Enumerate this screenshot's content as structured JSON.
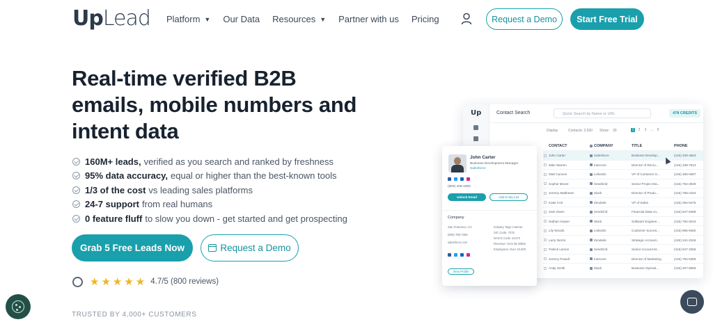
{
  "nav": {
    "logo_up": "Up",
    "logo_lead": "Lead",
    "menu": [
      {
        "label": "Platform",
        "dropdown": true
      },
      {
        "label": "Our Data",
        "dropdown": false
      },
      {
        "label": "Resources",
        "dropdown": true
      },
      {
        "label": "Partner with us",
        "dropdown": false
      },
      {
        "label": "Pricing",
        "dropdown": false
      }
    ],
    "request_demo": "Request a Demo",
    "start_trial": "Start Free Trial"
  },
  "hero": {
    "title": "Real-time verified B2B emails, mobile numbers and intent data",
    "features": [
      {
        "bold": "160M+ leads,",
        "rest": "verified as you search and ranked by freshness"
      },
      {
        "bold": "95% data accuracy,",
        "rest": "equal or higher than the best-known tools"
      },
      {
        "bold": "1/3 of the cost",
        "rest": "vs leading sales platforms"
      },
      {
        "bold": "24-7 support",
        "rest": "from real humans"
      },
      {
        "bold": "0 feature fluff",
        "rest": "to slow you down - get started and get prospecting"
      }
    ],
    "cta_primary": "Grab 5 Free Leads Now",
    "cta_secondary": "Request a Demo",
    "rating_text": "4.7/5 (800 reviews)",
    "stars": "★★★★★",
    "trusted": "TRUSTED BY 4,000+ CUSTOMERS"
  },
  "app": {
    "logo": "Up",
    "header_title": "Contact Search",
    "search_placeholder": "Quick Search by Name or URL",
    "credits": "478 CREDITS",
    "toolbar": {
      "display": "Display",
      "contacts": "Contacts: 2,500",
      "show": "Show:",
      "show_val": "30",
      "pages": [
        "1",
        "2",
        "3",
        "...",
        "9"
      ]
    },
    "columns": [
      "CONTACT",
      "COMPANY",
      "TITLE",
      "PHONE"
    ],
    "rows": [
      {
        "name": "John Carter",
        "company": "Salesforce",
        "title": "Business Develop...",
        "phone": "(415) 339-4563"
      },
      {
        "name": "Mike Warren",
        "company": "Intercom",
        "title": "Director of Recru...",
        "phone": "(415) 339-7513"
      },
      {
        "name": "Matt Cannon",
        "company": "LinkedIn",
        "title": "VP of Customer S...",
        "phone": "(415) 485-9487"
      },
      {
        "name": "Sophie Moore",
        "company": "SendGrid",
        "title": "Senior Project Ma...",
        "phone": "(415) 764-2849"
      },
      {
        "name": "Jeremy Matthews",
        "company": "Slack",
        "title": "Director of Produ...",
        "phone": "(415) 758-2154"
      },
      {
        "name": "Katie Corl",
        "company": "Zendesk",
        "title": "VP of Sales",
        "phone": "(415) 394-6475"
      },
      {
        "name": "Sam Owen",
        "company": "SendGrid",
        "title": "Financial Data An...",
        "phone": "(415) 847-6489"
      },
      {
        "name": "Nathan Harper",
        "company": "Slack",
        "title": "Software Enginee...",
        "phone": "(415) 784-9216"
      },
      {
        "name": "Lily Woods",
        "company": "LinkedIn",
        "title": "Customer Succes...",
        "phone": "(415) 895-9462"
      },
      {
        "name": "Larry Norris",
        "company": "Zendesk",
        "title": "Strategic Account...",
        "phone": "(415) 341-2346"
      },
      {
        "name": "Patrick Larson",
        "company": "SendGrid",
        "title": "Senior Account M...",
        "phone": "(415) 847-3256"
      },
      {
        "name": "Jeremy Powell",
        "company": "Intercom",
        "title": "Director of Marketing",
        "phone": "(415) 784-5369"
      },
      {
        "name": "Andy Smith",
        "company": "Slack",
        "title": "Business Operati...",
        "phone": "(415) 457-8569"
      }
    ]
  },
  "card": {
    "name": "John Carter",
    "title": "Business Development Manager",
    "company": "Salesforce",
    "phone": "(800) 409-1900",
    "unlock": "Unlock Email",
    "add_list": "Add to My List",
    "company_heading": "Company",
    "info_left": [
      "San Francisco, CA",
      "(800) 786-7393",
      "salesforce.com"
    ],
    "info_right": [
      "Industry Tags: Internet",
      "SIC Code: 7375",
      "NAICS Code: 54172",
      "Revenue: Over $1 Billion",
      "Employees: Over 10,000"
    ],
    "view_profile": "View Profile"
  },
  "colors": {
    "brand": "#1a9fac",
    "heading": "#18222f"
  }
}
